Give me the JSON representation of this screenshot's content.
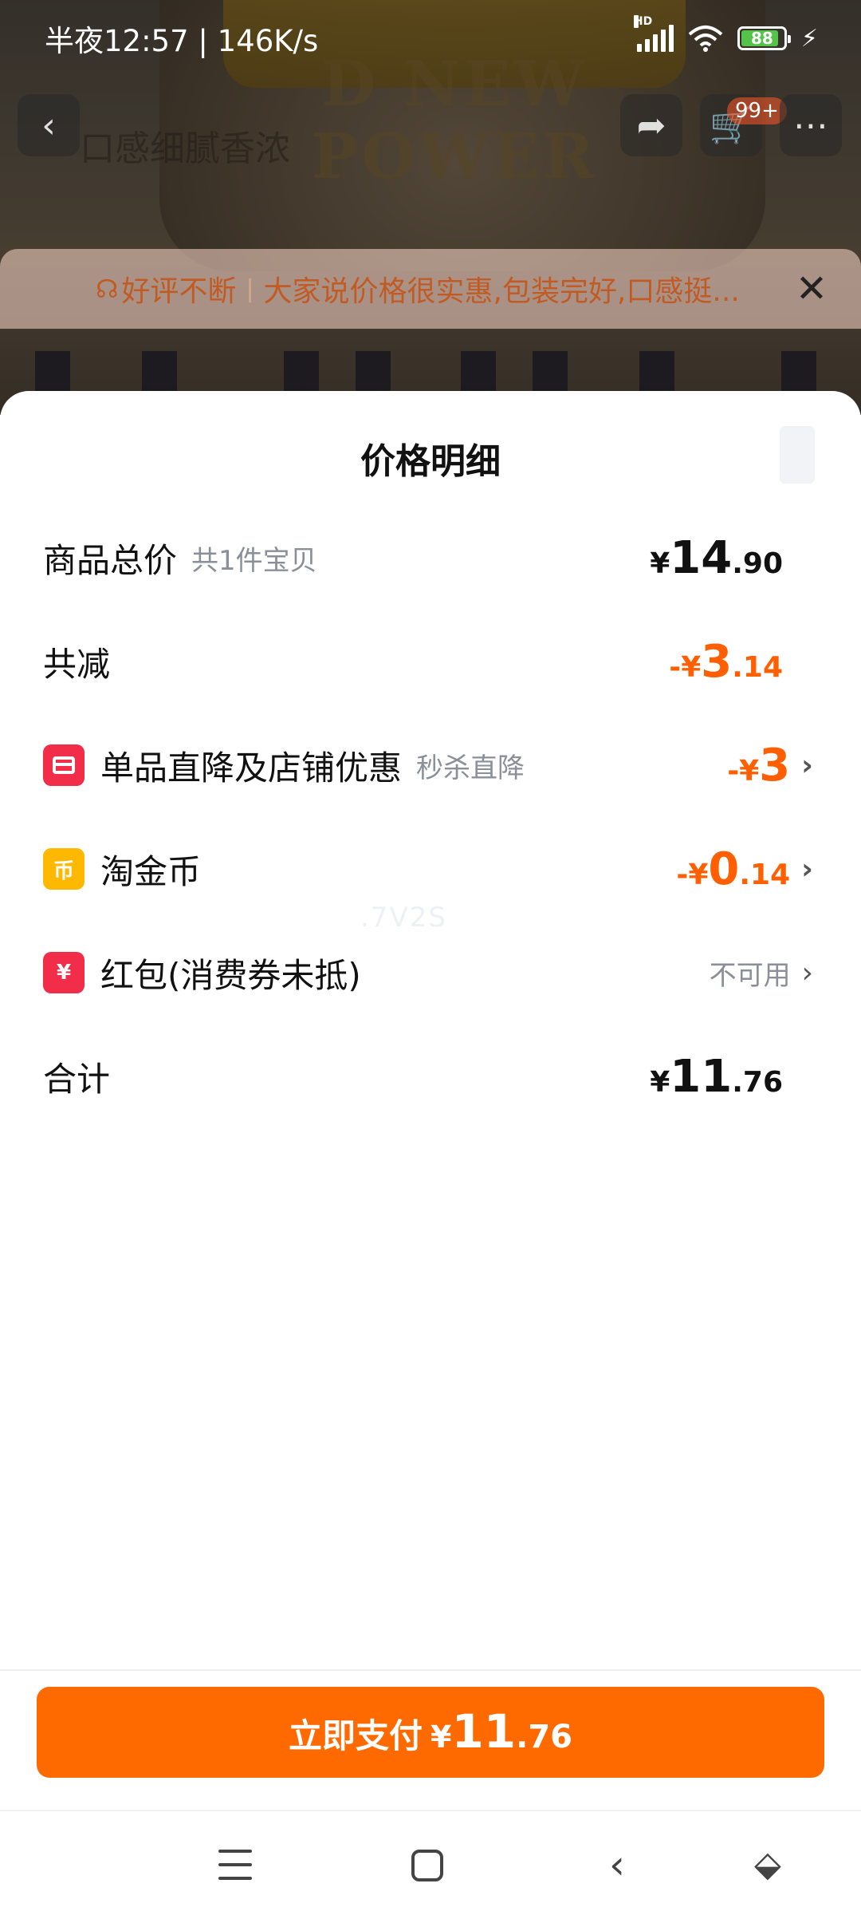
{
  "status_bar": {
    "time": "半夜12:57 | 146K/s",
    "network": "HD",
    "battery": "88",
    "battery_level": 0.88
  },
  "background": {
    "brand_text": "D NEW POWER",
    "title_fragment": "口感细腻香浓",
    "cart_badge": "99+"
  },
  "review_banner": {
    "tag": "好评不断",
    "message": "大家说价格很实惠,包装完好,口感挺..."
  },
  "sheet": {
    "title": "价格明细",
    "rows": [
      {
        "label": "商品总价",
        "sub": "共1件宝贝",
        "sym": "¥",
        "int": "14",
        "dec": ".90"
      },
      {
        "label": "共减",
        "sym": "-¥",
        "int": "3",
        "dec": ".14"
      },
      {
        "label": "单品直降及店铺优惠",
        "sub": "秒杀直降",
        "sym": "-¥",
        "int": "3",
        "dec": ""
      },
      {
        "label": "淘金币",
        "sym": "-¥",
        "int": "0",
        "dec": ".14"
      },
      {
        "label": "红包(消费券未抵)",
        "status": "不可用"
      },
      {
        "label": "合计",
        "sym": "¥",
        "int": "11",
        "dec": ".76"
      }
    ],
    "watermark": ".7V2S"
  },
  "pay_button": {
    "label": "立即支付",
    "sym": "¥",
    "int": "11",
    "dec": ".76"
  },
  "icons": {
    "store_discount": "store-icon",
    "coin": "币",
    "red_packet": "¥"
  },
  "colors": {
    "accent": "#ff6a00",
    "discount_text": "#ff5f00",
    "icon_red": "#f22d4a",
    "icon_gold": "#ffb800"
  }
}
